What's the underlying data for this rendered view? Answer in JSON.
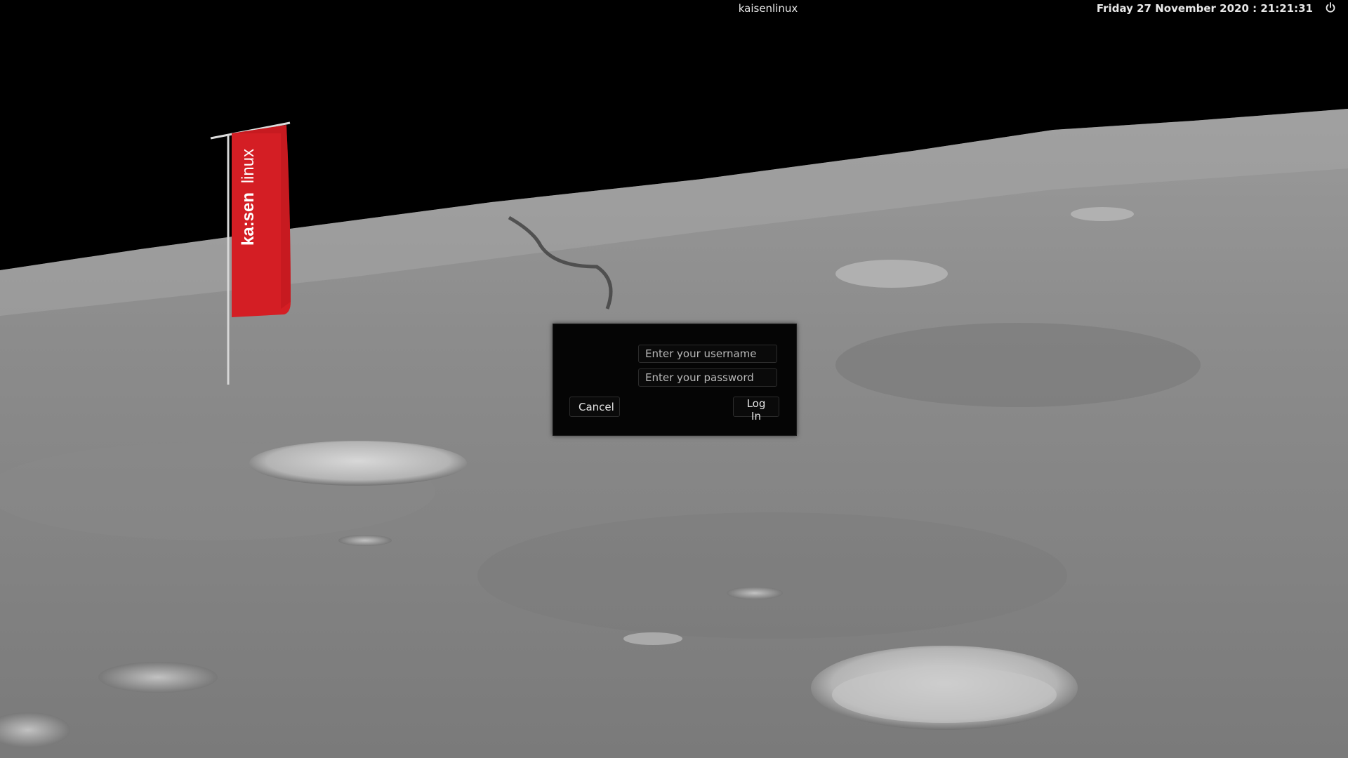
{
  "topbar": {
    "hostname": "kaisenlinux",
    "datetime": "Friday 27 November 2020 : 21:21:31",
    "power_icon": "power-icon"
  },
  "flag": {
    "brand_bold": "ka:sen",
    "brand_light": "linux",
    "color": "#d41e24"
  },
  "login": {
    "logo_icon": "dragon-logo-icon",
    "username_placeholder": "Enter your username",
    "password_placeholder": "Enter your password",
    "cancel_label": "Cancel",
    "login_label": "Log In"
  },
  "colors": {
    "sky": "#000000",
    "dialog_bg": "#050505",
    "accent_red": "#d41e24"
  }
}
